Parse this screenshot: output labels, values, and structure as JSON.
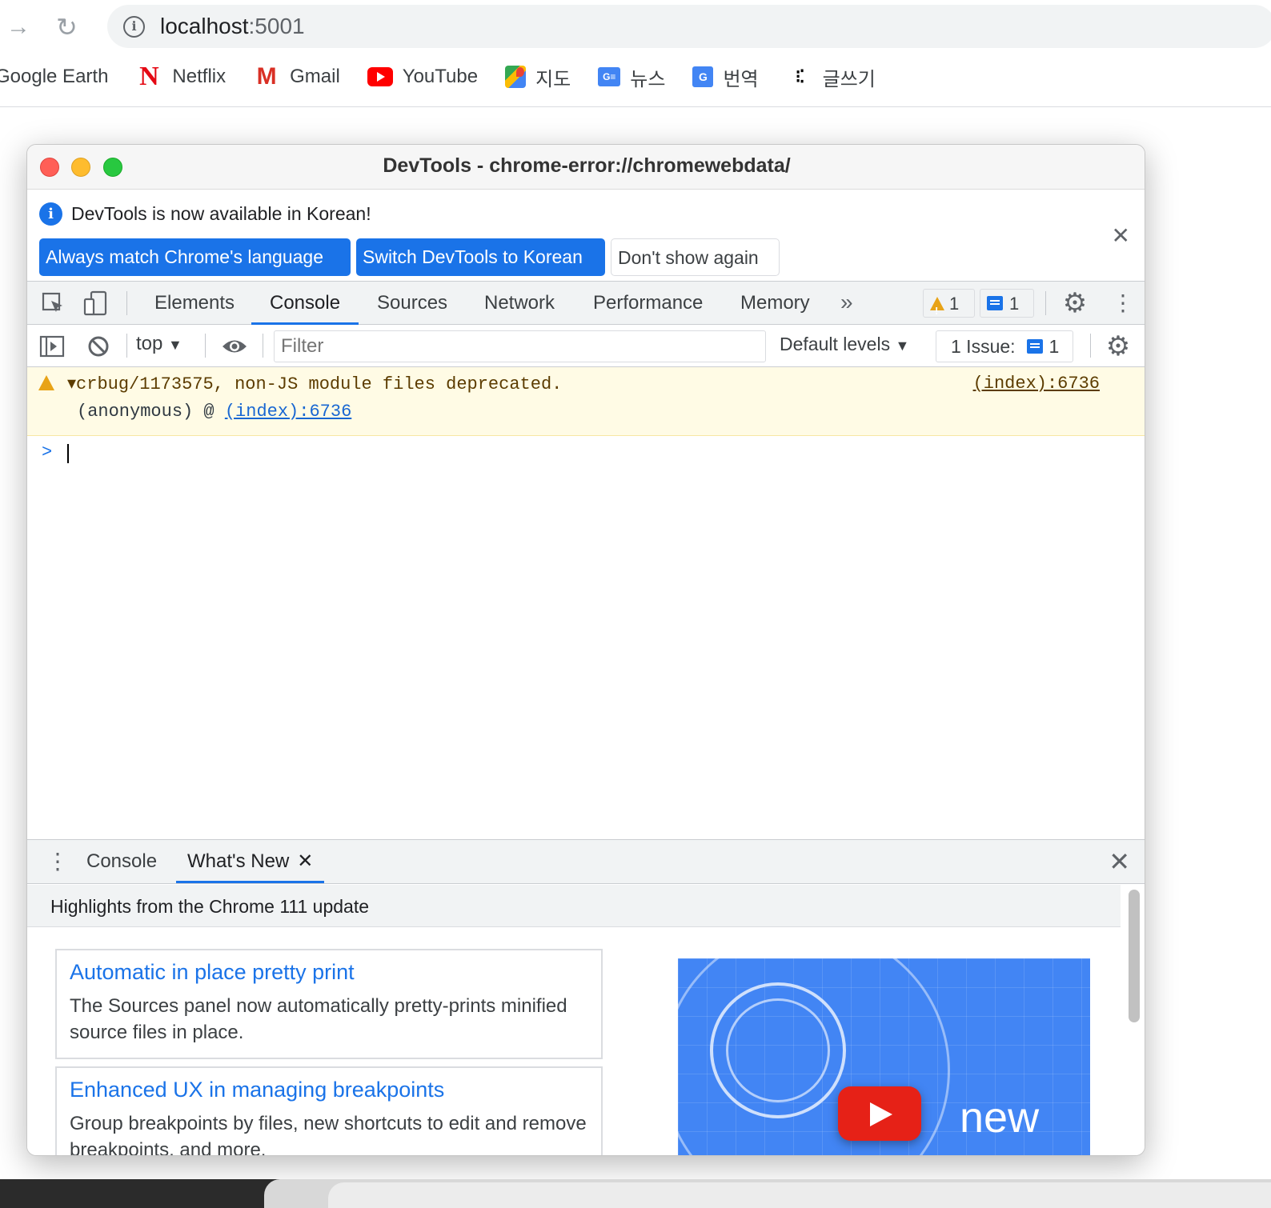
{
  "browser": {
    "url_host": "localhost",
    "url_port": ":5001",
    "bookmarks": [
      {
        "label": "Google Earth",
        "icon": "google-earth-icon"
      },
      {
        "label": "Netflix",
        "icon": "netflix-icon"
      },
      {
        "label": "Gmail",
        "icon": "gmail-icon"
      },
      {
        "label": "YouTube",
        "icon": "youtube-icon"
      },
      {
        "label": "지도",
        "icon": "maps-icon"
      },
      {
        "label": "뉴스",
        "icon": "news-icon"
      },
      {
        "label": "번역",
        "icon": "translate-icon"
      },
      {
        "label": "글쓰기",
        "icon": "write-icon"
      }
    ]
  },
  "devtools": {
    "title": "DevTools - chrome-error://chromewebdata/",
    "infobar": {
      "message": "DevTools is now available in Korean!",
      "buttons": {
        "match": "Always match Chrome's language",
        "switch": "Switch DevTools to Korean",
        "dont": "Don't show again"
      }
    },
    "tabs": [
      "Elements",
      "Console",
      "Sources",
      "Network",
      "Performance",
      "Memory"
    ],
    "active_tab": "Console",
    "warning_count": "1",
    "message_count": "1",
    "console_toolbar": {
      "context": "top",
      "filter_placeholder": "Filter",
      "levels": "Default levels",
      "issues_label": "1 Issue:",
      "issues_count": "1"
    },
    "console_messages": [
      {
        "type": "warning",
        "text": "crbug/1173575, non-JS module files deprecated.",
        "source": "(index):6736",
        "stack_prefix": "(anonymous) @ ",
        "stack_link": "(index):6736"
      }
    ],
    "drawer": {
      "tabs": [
        "Console",
        "What's New"
      ],
      "active_tab": "What's New",
      "whats_new": {
        "header": "Highlights from the Chrome 111 update",
        "cards": [
          {
            "title": "Automatic in place pretty print",
            "body": "The Sources panel now automatically pretty-prints minified source files in place."
          },
          {
            "title": "Enhanced UX in managing breakpoints",
            "body": "Group breakpoints by files, new shortcuts to edit and remove breakpoints, and more."
          }
        ],
        "video_word": "new"
      }
    }
  },
  "colors": {
    "accent": "#1a73e8",
    "warning_bg": "#fffbe5",
    "warning_icon": "#e8a317"
  }
}
